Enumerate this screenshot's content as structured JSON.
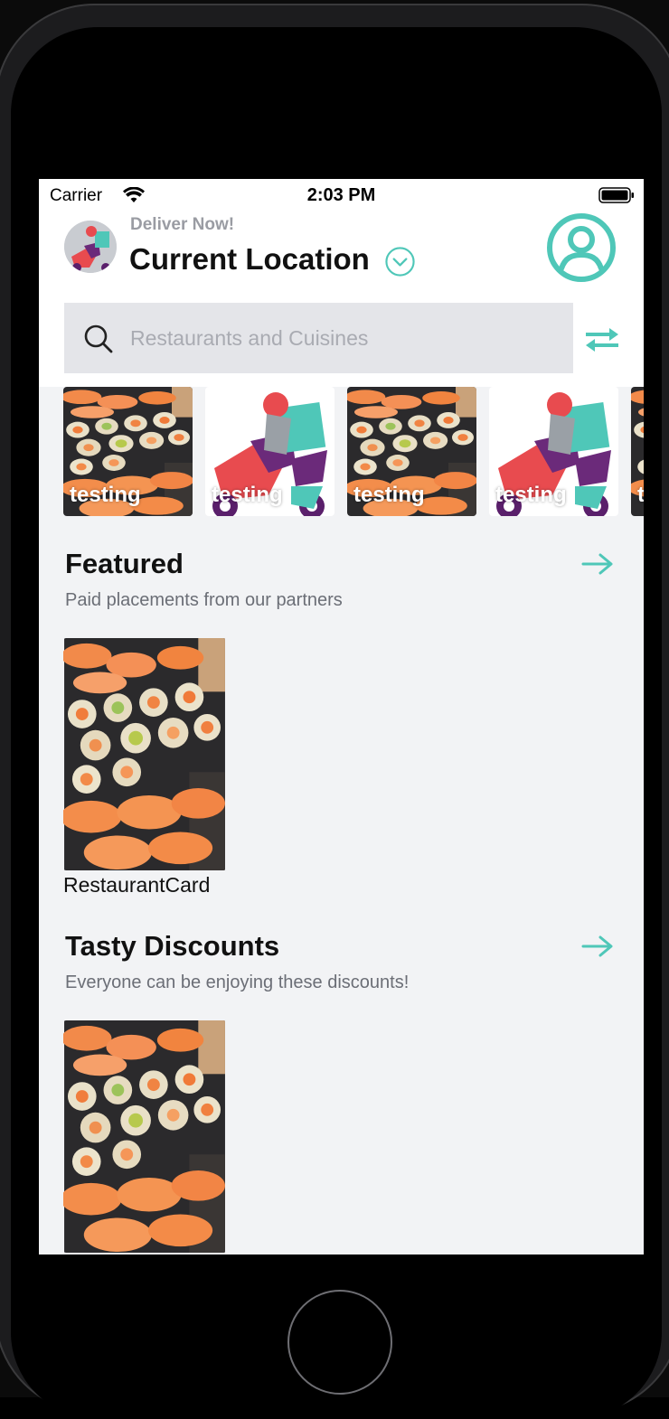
{
  "status_bar": {
    "carrier": "Carrier",
    "time": "2:03 PM"
  },
  "header": {
    "deliver_label": "Deliver Now!",
    "location_label": "Current Location",
    "search_placeholder": "Restaurants and Cuisines"
  },
  "carousel": {
    "items": [
      {
        "label": "testing",
        "image": "sushi"
      },
      {
        "label": "testing",
        "image": "rider"
      },
      {
        "label": "testing",
        "image": "sushi"
      },
      {
        "label": "testing",
        "image": "rider"
      },
      {
        "label": "testing",
        "image": "sushi"
      }
    ]
  },
  "sections": [
    {
      "title": "Featured",
      "subtitle": "Paid placements from our partners",
      "card_name": "RestaurantCard"
    },
    {
      "title": "Tasty Discounts",
      "subtitle": "Everyone can be enjoying these discounts!",
      "card_name": ""
    }
  ],
  "colors": {
    "accent": "#4fc7b8",
    "background": "#f2f3f5",
    "search_bg": "#e4e5e9"
  }
}
